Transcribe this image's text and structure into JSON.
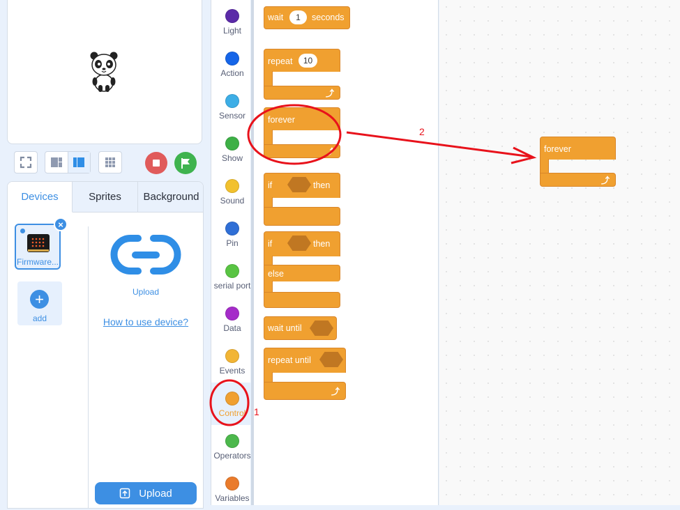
{
  "toolbar": {
    "fullscreen_icon": "fullscreen-icon",
    "small_layout_icon": "small-stage-icon",
    "large_layout_icon": "large-stage-icon",
    "grid_icon": "grid-icon",
    "stop_color": "#e05b5b",
    "go_color": "#3fb34f"
  },
  "tabs": [
    {
      "label": "Devices"
    },
    {
      "label": "Sprites"
    },
    {
      "label": "Background"
    }
  ],
  "device": {
    "name": "Firmware...",
    "add_label": "add",
    "upload_link_label": "Upload",
    "help_link": "How to use device?",
    "upload_button": "Upload"
  },
  "categories": [
    {
      "label": "Light",
      "color": "#5b2aa8"
    },
    {
      "label": "Action",
      "color": "#1565e8"
    },
    {
      "label": "Sensor",
      "color": "#3daee6"
    },
    {
      "label": "Show",
      "color": "#3db046"
    },
    {
      "label": "Sound",
      "color": "#f2c12e"
    },
    {
      "label": "Pin",
      "color": "#2f6fd6"
    },
    {
      "label": "serial port",
      "color": "#59c443"
    },
    {
      "label": "Data",
      "color": "#a52cc9"
    },
    {
      "label": "Events",
      "color": "#f2b535"
    },
    {
      "label": "Control",
      "color": "#f0a030"
    },
    {
      "label": "Operators",
      "color": "#4cb84c"
    },
    {
      "label": "Variables",
      "color": "#ea7b2b"
    }
  ],
  "blocks": {
    "wait": {
      "pre": "wait",
      "value": "1",
      "post": "seconds"
    },
    "repeat": {
      "label": "repeat",
      "value": "10"
    },
    "forever": {
      "label": "forever"
    },
    "if_then": {
      "if": "if",
      "then": "then"
    },
    "if_else": {
      "if": "if",
      "then": "then",
      "else": "else"
    },
    "wait_until": {
      "label": "wait until"
    },
    "repeat_until": {
      "label": "repeat until"
    }
  },
  "workspace_block": {
    "label": "forever"
  },
  "annotations": {
    "one": "1",
    "two": "2",
    "color": "#e8121b"
  }
}
